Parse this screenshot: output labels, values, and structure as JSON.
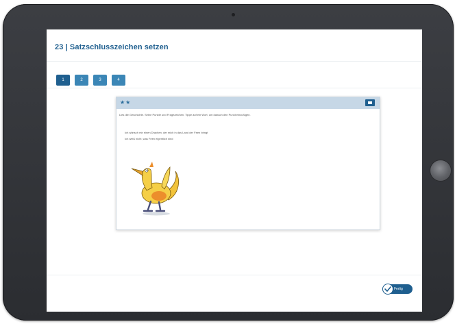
{
  "header": {
    "title": "23 | Satzschlusszeichen setzen"
  },
  "steps": [
    {
      "label": "1"
    },
    {
      "label": "2"
    },
    {
      "label": "3"
    },
    {
      "label": "4"
    }
  ],
  "card": {
    "difficulty": "★★",
    "instruction": "Lies die Geschichte. Setze Punkte und Fragezeichen. Tippe auf ein Wort, um danach den Punkt einzufügen.",
    "lines": [
      "Ich wünsch mir einen Drachen, der mich in das Land der Feen bringt",
      "Ich weiß nicht, was Feen eigentlich sind"
    ]
  },
  "footer": {
    "done_label": "Fertig"
  },
  "colors": {
    "primary": "#1f5f8f",
    "step": "#3b86b6",
    "card_header": "#c6d7e6",
    "device": "#34363b"
  }
}
